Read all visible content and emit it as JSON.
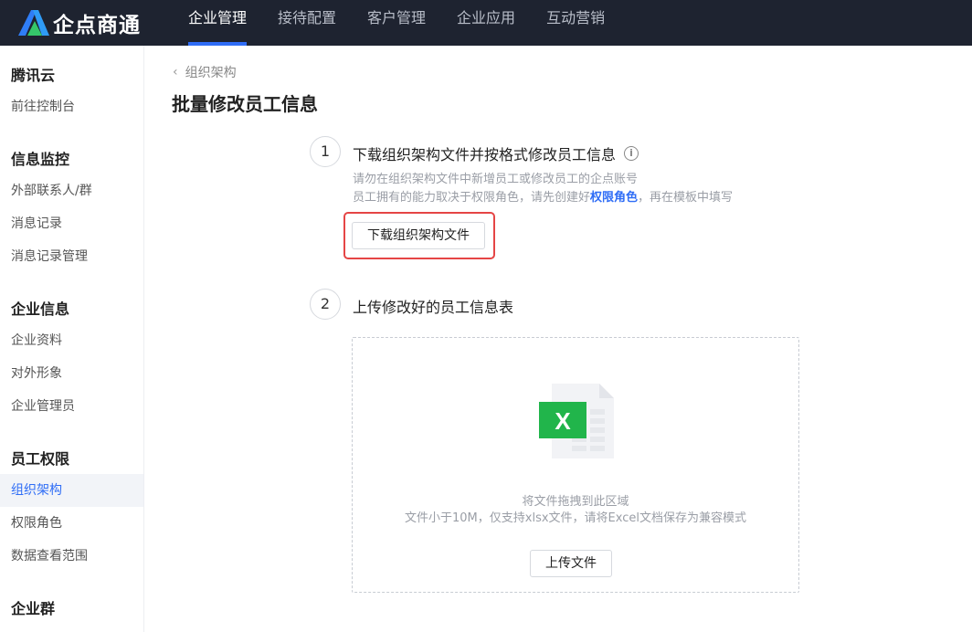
{
  "app": {
    "brand": "企点商通"
  },
  "nav": [
    {
      "label": "企业管理",
      "active": true
    },
    {
      "label": "接待配置",
      "active": false
    },
    {
      "label": "客户管理",
      "active": false
    },
    {
      "label": "企业应用",
      "active": false
    },
    {
      "label": "互动营销",
      "active": false
    }
  ],
  "sidebar": {
    "groups": [
      {
        "title": "腾讯云",
        "items": [
          "前往控制台"
        ]
      },
      {
        "title": "信息监控",
        "items": [
          "外部联系人/群",
          "消息记录",
          "消息记录管理"
        ]
      },
      {
        "title": "企业信息",
        "items": [
          "企业资料",
          "对外形象",
          "企业管理员"
        ]
      },
      {
        "title": "员工权限",
        "items": [
          "组织架构",
          "权限角色",
          "数据查看范围"
        ]
      },
      {
        "title": "企业群",
        "items": []
      }
    ],
    "active_item": "组织架构"
  },
  "breadcrumb": {
    "label": "组织架构"
  },
  "page": {
    "title": "批量修改员工信息"
  },
  "step1": {
    "number": "1",
    "title": "下载组织架构文件并按格式修改员工信息",
    "desc_line1": "请勿在组织架构文件中新增员工或修改员工的企点账号",
    "desc_line2_prefix": "员工拥有的能力取决于权限角色，请先创建好",
    "desc_line2_link": "权限角色",
    "desc_line2_suffix": "，再在模板中填写",
    "button_label": "下载组织架构文件"
  },
  "step2": {
    "number": "2",
    "title": "上传修改好的员工信息表",
    "drop_hint": "将文件拖拽到此区域",
    "limit_hint": "文件小于10M，仅支持xlsx文件，请将Excel文档保存为兼容模式",
    "button_label": "上传文件",
    "file_icon_letter": "X"
  },
  "colors": {
    "accent": "#2f6df6",
    "topbar": "#1e2330",
    "highlight": "#e54545",
    "excel": "#21b54b"
  }
}
